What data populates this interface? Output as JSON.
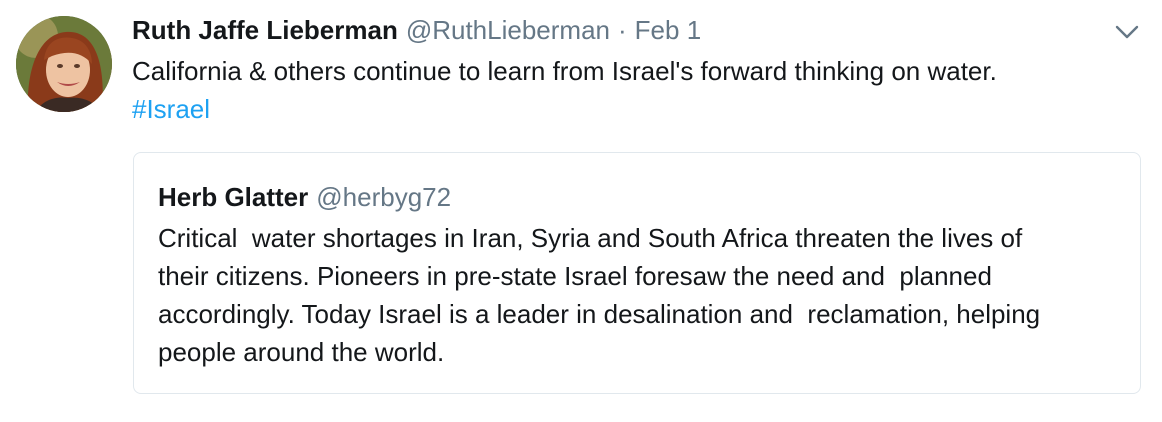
{
  "tweet": {
    "author_name": "Ruth Jaffe Lieberman",
    "author_handle": "@RuthLieberman",
    "separator": "·",
    "date": "Feb 1",
    "text_line1": "California & others continue to learn from Israel's forward thinking on water.",
    "hashtag": "#Israel",
    "avatar_icon": "profile-photo",
    "menu_icon": "chevron-down-icon",
    "colors": {
      "link": "#1da1f2",
      "secondary_text": "#657786",
      "border": "#e1e8ed"
    }
  },
  "quoted_tweet": {
    "author_name": "Herb Glatter",
    "author_handle": "@herbyg72",
    "lines": [
      "Critical  water shortages in Iran, Syria and South Africa threaten the lives of",
      "their citizens. Pioneers in pre-state Israel foresaw the need and  planned",
      "accordingly. Today Israel is a leader in desalination and  reclamation, helping",
      "people around the world."
    ]
  }
}
